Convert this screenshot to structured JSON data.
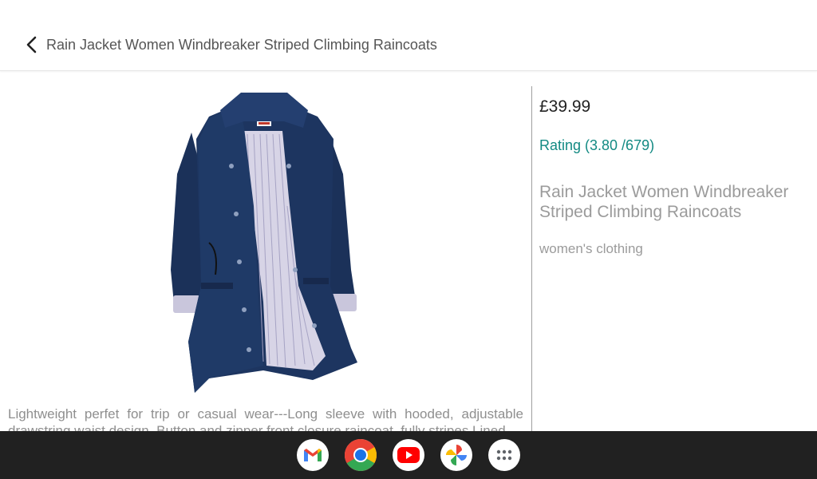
{
  "header": {
    "title": "Rain Jacket Women Windbreaker Striped Climbing Raincoats",
    "back_icon": "chevron-left-icon"
  },
  "product": {
    "image_icon": "navy-rain-jacket-image",
    "price": "£39.99",
    "rating": "Rating (3.80 /679)",
    "name": "Rain Jacket Women Windbreaker Striped Climbing Raincoats",
    "category": "women's clothing",
    "description": "Lightweight perfet for trip or casual wear---Long sleeve with hooded, adjustable drawstring waist design. Button and zipper front closure raincoat, fully stripes Lined"
  },
  "colors": {
    "accent": "#138a83",
    "jacket": "#1d3560",
    "dock": "#212121"
  },
  "dock": {
    "apps": [
      "gmail-icon",
      "chrome-icon",
      "youtube-icon",
      "photos-icon",
      "app-launcher-icon"
    ]
  }
}
